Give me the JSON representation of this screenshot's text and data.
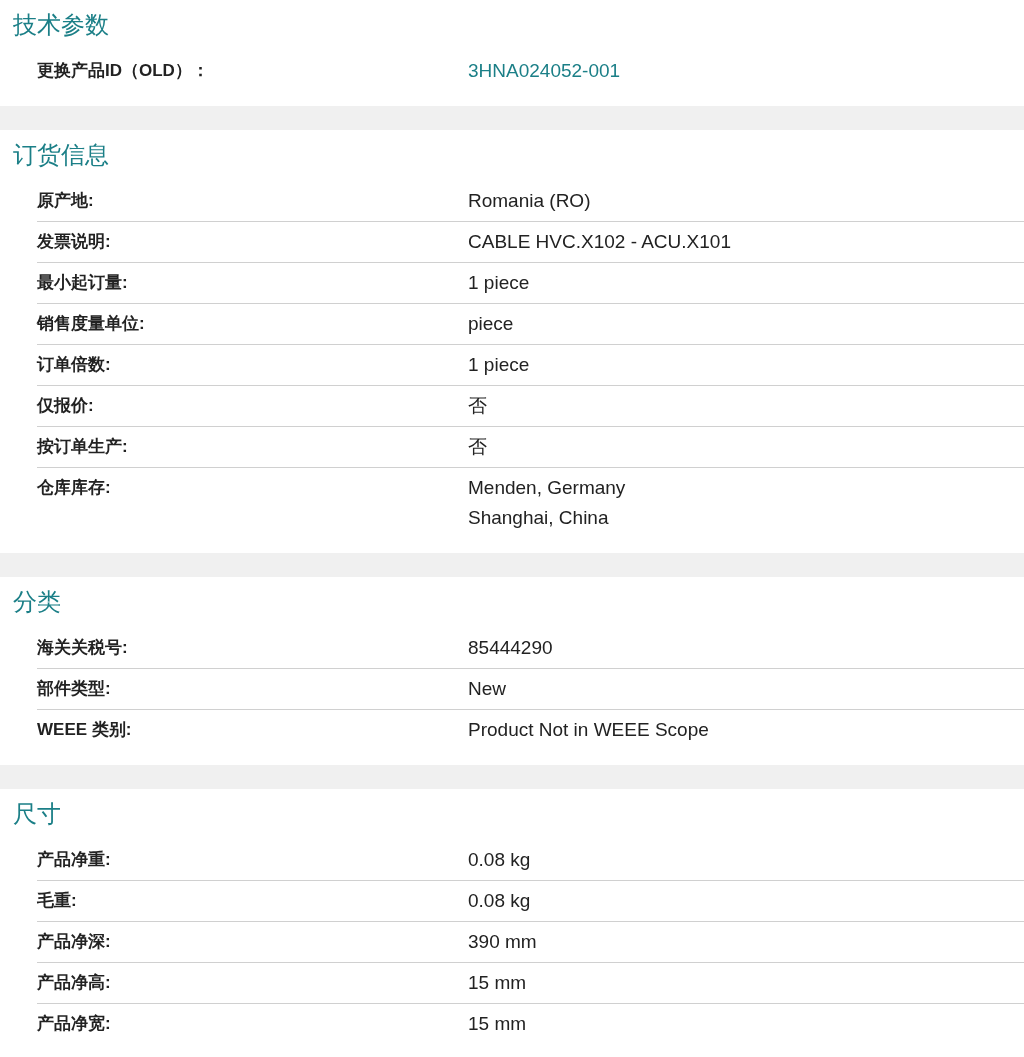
{
  "sections": [
    {
      "title": "技术参数",
      "rows": [
        {
          "label": "更换产品ID（OLD）：",
          "kind": "link",
          "lines": [
            "3HNA024052-001"
          ]
        }
      ]
    },
    {
      "title": "订货信息",
      "rows": [
        {
          "label": "原产地:",
          "kind": "text",
          "lines": [
            "Romania (RO)"
          ]
        },
        {
          "label": "发票说明:",
          "kind": "text",
          "lines": [
            "CABLE HVC.X102 - ACU.X101"
          ]
        },
        {
          "label": "最小起订量:",
          "kind": "text",
          "lines": [
            "1 piece"
          ]
        },
        {
          "label": "销售度量单位:",
          "kind": "text",
          "lines": [
            "piece"
          ]
        },
        {
          "label": "订单倍数:",
          "kind": "text",
          "lines": [
            "1 piece"
          ]
        },
        {
          "label": "仅报价:",
          "kind": "text",
          "lines": [
            "否"
          ]
        },
        {
          "label": "按订单生产:",
          "kind": "text",
          "lines": [
            "否"
          ]
        },
        {
          "label": "仓库库存:",
          "kind": "text",
          "lines": [
            "Menden, Germany",
            "Shanghai, China"
          ]
        }
      ]
    },
    {
      "title": "分类",
      "rows": [
        {
          "label": "海关关税号:",
          "kind": "text",
          "lines": [
            "85444290"
          ]
        },
        {
          "label": "部件类型:",
          "kind": "text",
          "lines": [
            "New"
          ]
        },
        {
          "label": "WEEE 类别:",
          "kind": "text",
          "lines": [
            "Product Not in WEEE Scope"
          ]
        }
      ]
    },
    {
      "title": "尺寸",
      "rows": [
        {
          "label": "产品净重:",
          "kind": "text",
          "lines": [
            "0.08 kg"
          ]
        },
        {
          "label": "毛重:",
          "kind": "text",
          "lines": [
            "0.08 kg"
          ]
        },
        {
          "label": "产品净深:",
          "kind": "text",
          "lines": [
            "390 mm"
          ]
        },
        {
          "label": "产品净高:",
          "kind": "text",
          "lines": [
            "15 mm"
          ]
        },
        {
          "label": "产品净宽:",
          "kind": "text",
          "lines": [
            "15 mm"
          ]
        }
      ]
    }
  ]
}
